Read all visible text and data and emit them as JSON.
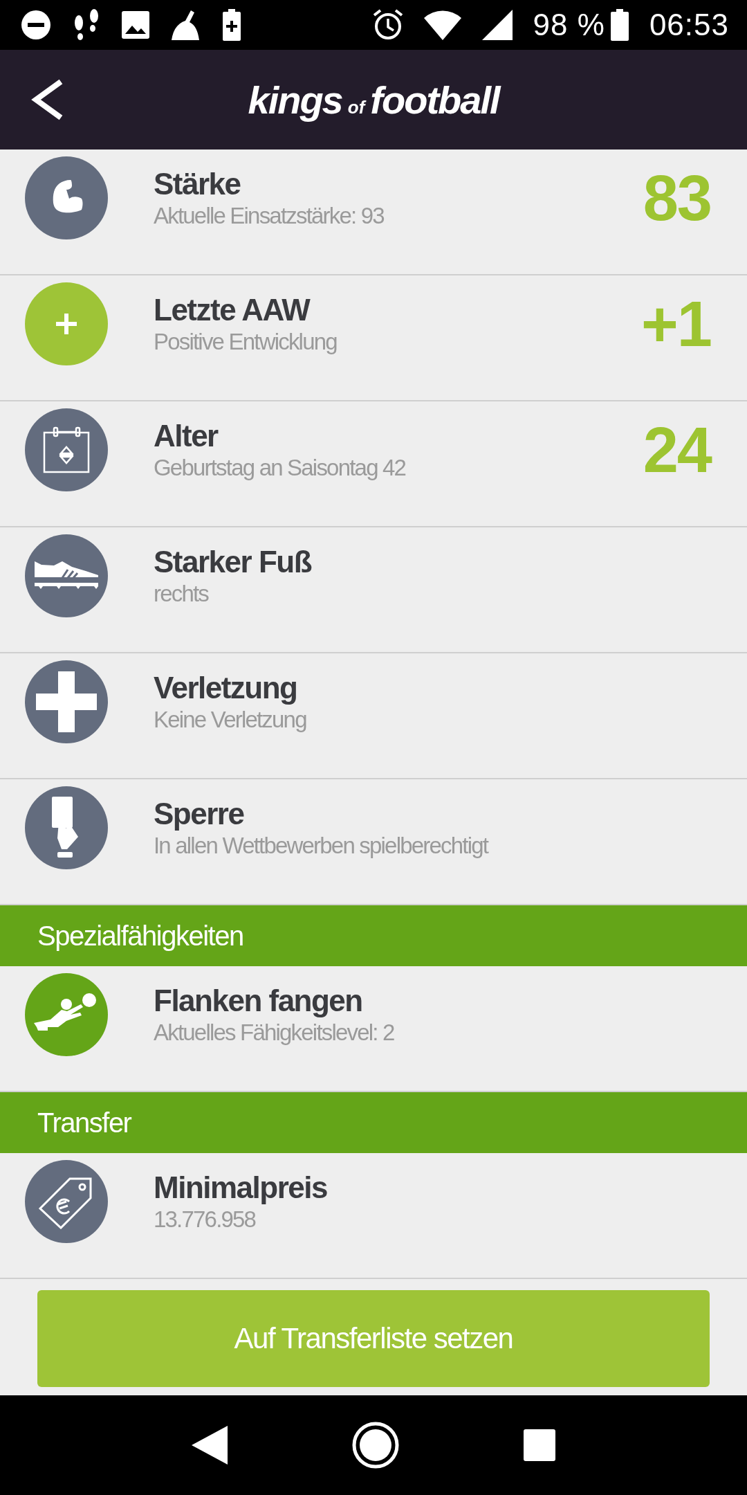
{
  "status_bar": {
    "battery": "98 %",
    "time": "06:53"
  },
  "header": {
    "logo": [
      "kings",
      "of",
      "football"
    ]
  },
  "attributes": [
    {
      "kind": "strength",
      "title": "Stärke",
      "subtitle": "Aktuelle Einsatzstärke: 93",
      "value": "83",
      "color": "#636c7e"
    },
    {
      "kind": "development",
      "title": "Letzte AAW",
      "subtitle": "Positive Entwicklung",
      "value": "+1",
      "color": "#9ec437"
    },
    {
      "kind": "age",
      "title": "Alter",
      "subtitle": "Geburtstag an Saisontag 42",
      "value": "24",
      "color": "#636c7e"
    },
    {
      "kind": "foot",
      "title": "Starker Fuß",
      "subtitle": "rechts",
      "color": "#636c7e"
    },
    {
      "kind": "injury",
      "title": "Verletzung",
      "subtitle": "Keine Verletzung",
      "color": "#636c7e"
    },
    {
      "kind": "suspension",
      "title": "Sperre",
      "subtitle": "In allen Wettbewerben spielberechtigt",
      "color": "#636c7e"
    }
  ],
  "sections": [
    {
      "title": "Spezialfähigkeiten",
      "rows": [
        {
          "kind": "skill",
          "title": "Flanken fangen",
          "subtitle": "Aktuelles Fähigkeitslevel: 2",
          "color": "#64a518"
        }
      ]
    },
    {
      "title": "Transfer",
      "rows": [
        {
          "kind": "price",
          "title": "Minimalpreis",
          "subtitle": "13.776.958",
          "color": "#636c7e"
        }
      ]
    }
  ],
  "button": {
    "label": "Auf Transferliste setzen"
  }
}
